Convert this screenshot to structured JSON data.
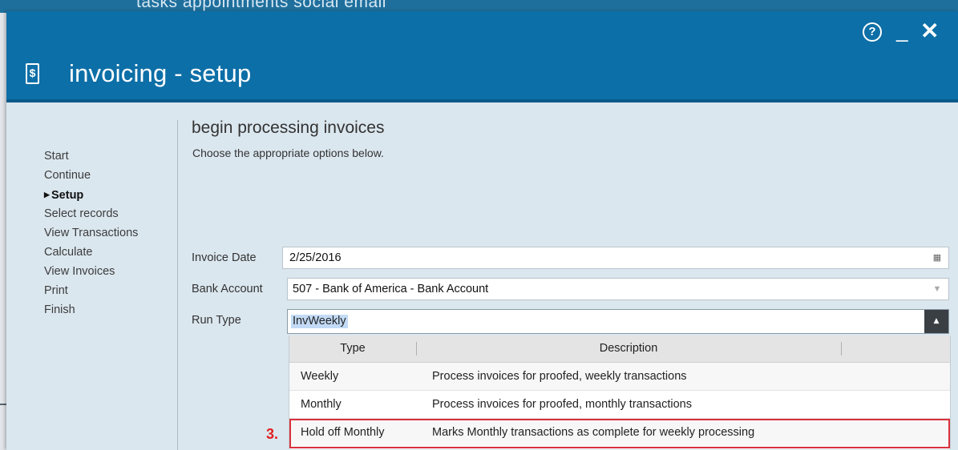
{
  "background": {
    "top_text": "tasks   appointments   social   email"
  },
  "window": {
    "title": "invoicing - setup",
    "app_icon": "invoice-dollar-icon",
    "controls": {
      "help": "?",
      "minimize": "_",
      "close": "✕"
    }
  },
  "nav": {
    "items": [
      {
        "label": "Start",
        "active": false
      },
      {
        "label": "Continue",
        "active": false
      },
      {
        "label": "Setup",
        "active": true
      },
      {
        "label": "Select records",
        "active": false
      },
      {
        "label": "View Transactions",
        "active": false
      },
      {
        "label": "Calculate",
        "active": false
      },
      {
        "label": "View Invoices",
        "active": false
      },
      {
        "label": "Print",
        "active": false
      },
      {
        "label": "Finish",
        "active": false
      }
    ]
  },
  "main": {
    "heading": "begin processing invoices",
    "subheading": "Choose the appropriate options below.",
    "fields": {
      "invoice_date": {
        "label": "Invoice Date",
        "value": "2/25/2016",
        "icon": "calendar-icon"
      },
      "bank_account": {
        "label": "Bank Account",
        "value": "507 - Bank of America - Bank Account",
        "icon": "chevron-down-icon"
      },
      "run_type": {
        "label": "Run Type",
        "value": "InvWeekly",
        "icon": "chevron-up-icon"
      }
    },
    "dropdown": {
      "columns": [
        "Type",
        "Description"
      ],
      "rows": [
        {
          "type": "Weekly",
          "description": "Process invoices for proofed, weekly transactions"
        },
        {
          "type": "Monthly",
          "description": "Process invoices for proofed, monthly transactions"
        },
        {
          "type": "Hold off Monthly",
          "description": "Marks Monthly transactions as complete for weekly processing"
        }
      ]
    },
    "annotation": {
      "step": "3.",
      "color": "#d9323c"
    }
  },
  "colors": {
    "titlebar": "#0d6fa7",
    "content_bg": "#dbe7ef"
  }
}
